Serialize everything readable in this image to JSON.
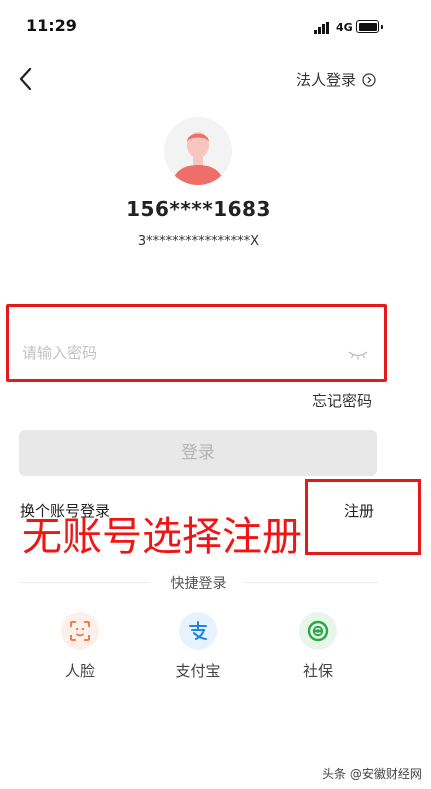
{
  "status_bar": {
    "time": "11:29",
    "network": "4G"
  },
  "header": {
    "legal_login": "法人登录"
  },
  "account": {
    "phone": "156****1683",
    "id_number": "3****************X"
  },
  "password": {
    "placeholder": "请输入密码"
  },
  "links": {
    "forgot": "忘记密码",
    "switch_account": "换个账号登录",
    "register": "注册"
  },
  "login_button": "登录",
  "annotation": "无账号选择注册",
  "quick_login": {
    "title": "快捷登录",
    "items": [
      {
        "label": "人脸",
        "icon": "face-scan-icon",
        "color": "#e9743c"
      },
      {
        "label": "支付宝",
        "icon": "alipay-icon",
        "color": "#1a86e8"
      },
      {
        "label": "社保",
        "icon": "social-security-icon",
        "color": "#2aa846"
      }
    ]
  },
  "watermark": "头条 @安徽财经网",
  "colors": {
    "highlight_red": "#e3191c",
    "annotation_red": "#f01515",
    "disabled_button": "#e8e8e8"
  }
}
